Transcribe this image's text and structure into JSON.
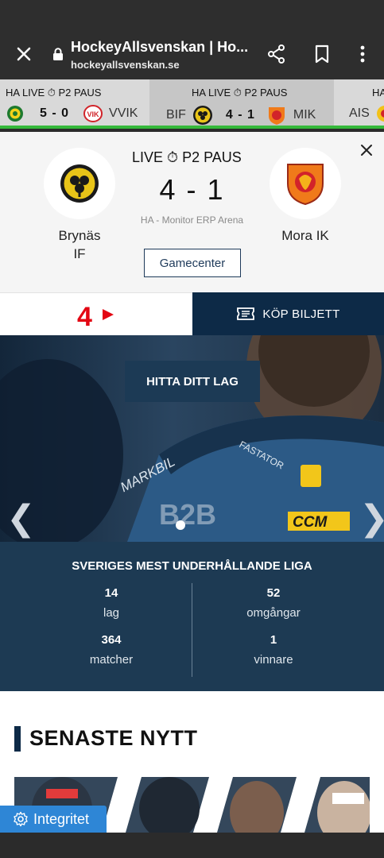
{
  "browser": {
    "title": "HockeyAllsvenskan | Ho...",
    "url": "hockeyallsvenskan.se"
  },
  "ticker": [
    {
      "status": "HA LIVE ⏱ P2 PAUS",
      "score": "5 - 0",
      "away": "VVIK"
    },
    {
      "status": "HA LIVE ⏱ P2 PAUS",
      "home": "BIF",
      "score": "4 - 1",
      "away": "MIK"
    },
    {
      "status": "HA",
      "home": "AIS"
    }
  ],
  "match": {
    "status": "LIVE ⏱ P2 PAUS",
    "score": "4 - 1",
    "venue": "HA - Monitor ERP Arena",
    "home_name_line1": "Brynäs",
    "home_name_line2": "IF",
    "away_name": "Mora IK",
    "gamecenter_label": "Gamecenter"
  },
  "partner": {
    "tv4_label": "4",
    "ticket_label": "KÖP BILJETT"
  },
  "hero": {
    "button_label": "HITTA DITT LAG",
    "prev": "❮",
    "next": "❯"
  },
  "stats": {
    "heading": "SVERIGES MEST UNDERHÅLLANDE LIGA",
    "items": [
      {
        "value": "14",
        "label": "lag"
      },
      {
        "value": "52",
        "label": "omgångar"
      },
      {
        "value": "364",
        "label": "matcher"
      },
      {
        "value": "1",
        "label": "vinnare"
      }
    ]
  },
  "news": {
    "heading": "SENASTE NYTT"
  },
  "privacy": {
    "label": "Integritet"
  },
  "colors": {
    "navy": "#0d2a47",
    "ticker_bg": "#d9d9d9",
    "ticker_accent": "#35b93a",
    "privacy_blue": "#2e86d6"
  }
}
